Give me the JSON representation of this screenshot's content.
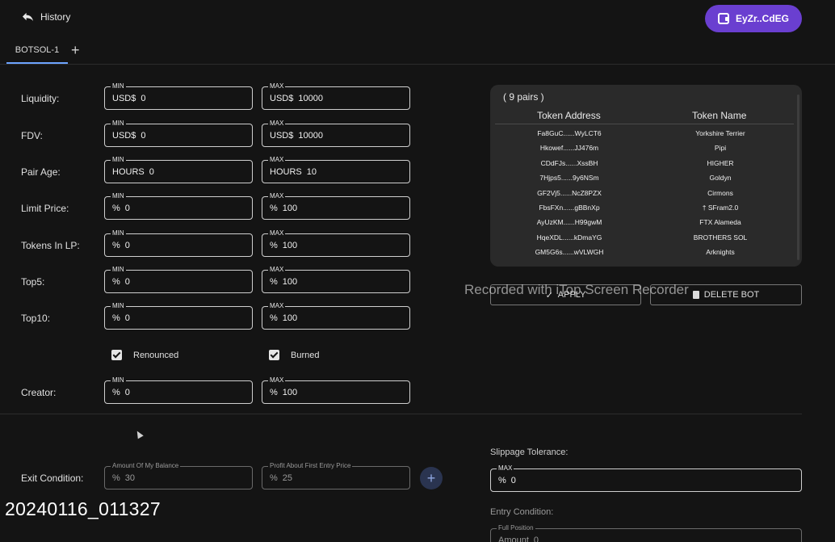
{
  "header": {
    "history_label": "History",
    "wallet_label": "EyZr..CdEG"
  },
  "tabs": [
    {
      "label": "BOTSOL-1"
    }
  ],
  "filters": [
    {
      "label": "Liquidity:",
      "min": {
        "prefix": "USD$",
        "value": "0"
      },
      "max": {
        "prefix": "USD$",
        "value": "10000"
      }
    },
    {
      "label": "FDV:",
      "min": {
        "prefix": "USD$",
        "value": "0"
      },
      "max": {
        "prefix": "USD$",
        "value": "10000"
      }
    },
    {
      "label": "Pair Age:",
      "min": {
        "prefix": "HOURS",
        "value": "0"
      },
      "max": {
        "prefix": "HOURS",
        "value": "10"
      }
    },
    {
      "label": "Limit Price:",
      "min": {
        "prefix": "%",
        "value": "0"
      },
      "max": {
        "prefix": "%",
        "value": "100"
      }
    },
    {
      "label": "Tokens In LP:",
      "min": {
        "prefix": "%",
        "value": "0"
      },
      "max": {
        "prefix": "%",
        "value": "100"
      }
    },
    {
      "label": "Top5:",
      "min": {
        "prefix": "%",
        "value": "0"
      },
      "max": {
        "prefix": "%",
        "value": "100"
      }
    },
    {
      "label": "Top10:",
      "min": {
        "prefix": "%",
        "value": "0"
      },
      "max": {
        "prefix": "%",
        "value": "100"
      }
    }
  ],
  "field_labels": {
    "min": "MIN",
    "max": "MAX"
  },
  "checkboxes": {
    "renounced": "Renounced",
    "burned": "Burned"
  },
  "creator": {
    "label": "Creator:",
    "min": {
      "prefix": "%",
      "value": "0"
    },
    "max": {
      "prefix": "%",
      "value": "100"
    }
  },
  "pairs": {
    "count_label": "( 9 pairs )",
    "col_address": "Token Address",
    "col_name": "Token Name",
    "rows": [
      {
        "address": "Fa8GuC......WyLCT6",
        "name": "Yorkshire Terrier"
      },
      {
        "address": "Hkowef......JJ476m",
        "name": "Pipi"
      },
      {
        "address": "CDdFJs......XssBH",
        "name": "HIGHER"
      },
      {
        "address": "7Hjps5......9y6NSm",
        "name": "Goldyn"
      },
      {
        "address": "GF2Vj5......NcZ8PZX",
        "name": "Cirmons"
      },
      {
        "address": "FbsFXn......gBBnXp",
        "name": "† SFram2.0"
      },
      {
        "address": "AyUzKM......H99gwM",
        "name": "FTX Alameda"
      },
      {
        "address": "HqeXDL......kDmaYG",
        "name": "BROTHERS SOL"
      },
      {
        "address": "GM5G6s......wVLWGH",
        "name": "Arknights"
      }
    ]
  },
  "actions": {
    "apply": "APPLY",
    "delete": "DELETE BOT"
  },
  "watermark": "Recorded with iTop Screen Recorder",
  "exit": {
    "label": "Exit Condition:",
    "balance": {
      "label": "Amount Of My Balance",
      "prefix": "%",
      "value": "30"
    },
    "profit": {
      "label": "Profit About First Entry Price",
      "prefix": "%",
      "value": "25"
    },
    "add": "+"
  },
  "slippage": {
    "label": "Slippage Tolerance:",
    "field_label": "MAX",
    "prefix": "%",
    "value": "0"
  },
  "entry": {
    "label": "Entry Condition:",
    "field_label": "Full Position",
    "prefix": "Amount",
    "value": "0"
  },
  "timestamp": "20240116_011327"
}
